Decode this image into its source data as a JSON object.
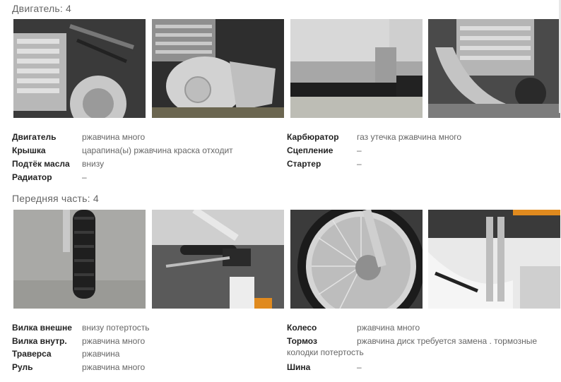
{
  "engine": {
    "title": "Двигатель: 4",
    "specs_left": [
      {
        "label": "Двигатель",
        "value": "ржавчина много"
      },
      {
        "label": "Крышка",
        "value": "царапина(ы) ржавчина краска отходит"
      },
      {
        "label": "Подтёк масла",
        "value": "внизу"
      },
      {
        "label": "Радиатор",
        "value": "–"
      }
    ],
    "specs_right": [
      {
        "label": "Карбюратор",
        "value": "газ утечка ржавчина много"
      },
      {
        "label": "Сцепление",
        "value": "–"
      },
      {
        "label": "Стартер",
        "value": "–"
      }
    ]
  },
  "front": {
    "title": "Передняя часть: 4",
    "specs_left": [
      {
        "label": "Вилка внешне",
        "value": "внизу потертость"
      },
      {
        "label": "Вилка внутр.",
        "value": "ржавчина много"
      },
      {
        "label": "Траверса",
        "value": "ржавчина"
      },
      {
        "label": "Руль",
        "value": "ржавчина много"
      }
    ],
    "specs_right": [
      {
        "label": "Колесо",
        "value": "ржавчина много"
      },
      {
        "label": "Тормоз",
        "value": "ржавчина диск требуется замена . тормозные"
      },
      {
        "label": "",
        "value": "колодки потертость"
      },
      {
        "label": "Шина",
        "value": "–"
      }
    ]
  },
  "colors": {
    "label": "#222222",
    "value": "#666666",
    "title": "#666666"
  }
}
